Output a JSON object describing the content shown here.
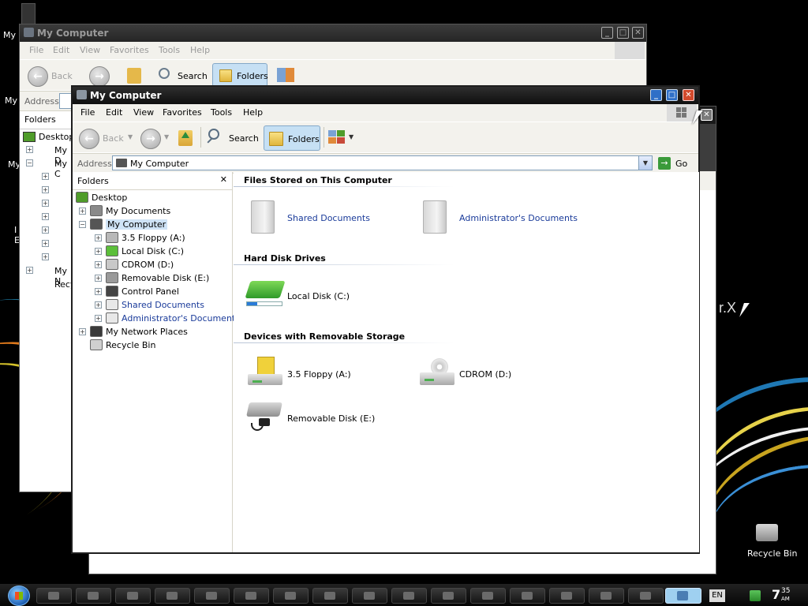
{
  "desktop": {
    "recycle_bin_label": "Recycle Bin",
    "right_text": "r.X",
    "left_labels": [
      "My I",
      "My",
      "My",
      "I",
      "E"
    ]
  },
  "back_window": {
    "title": "My Computer",
    "menu": [
      "File",
      "Edit",
      "View",
      "Favorites",
      "Tools",
      "Help"
    ],
    "toolbar": {
      "back": "Back",
      "search": "Search",
      "folders": "Folders"
    },
    "address_label": "Address",
    "folders_label": "Folders",
    "tree": [
      "Desktop",
      "My D",
      "My C",
      "My N",
      "Recy"
    ]
  },
  "front_window": {
    "title": "My Computer",
    "menu": [
      "File",
      "Edit",
      "View",
      "Favorites",
      "Tools",
      "Help"
    ],
    "toolbar": {
      "back": "Back",
      "search": "Search",
      "folders": "Folders"
    },
    "address": {
      "label": "Address",
      "value": "My Computer",
      "go": "Go"
    },
    "folders_pane": {
      "header": "Folders",
      "close_glyph": "✕",
      "tree": [
        {
          "label": "Desktop",
          "level": 0,
          "icon": "desktop-icon"
        },
        {
          "label": "My Documents",
          "level": 1,
          "icon": "my-documents-icon"
        },
        {
          "label": "My Computer",
          "level": 1,
          "icon": "my-computer-icon",
          "selected": true
        },
        {
          "label": "3.5 Floppy (A:)",
          "level": 2,
          "icon": "floppy-icon"
        },
        {
          "label": "Local Disk (C:)",
          "level": 2,
          "icon": "local-disk-icon"
        },
        {
          "label": "CDROM (D:)",
          "level": 2,
          "icon": "cdrom-icon"
        },
        {
          "label": "Removable Disk (E:)",
          "level": 2,
          "icon": "removable-disk-icon"
        },
        {
          "label": "Control Panel",
          "level": 2,
          "icon": "control-panel-icon"
        },
        {
          "label": "Shared Documents",
          "level": 2,
          "icon": "shared-documents-icon"
        },
        {
          "label": "Administrator's Documents",
          "level": 2,
          "icon": "admin-documents-icon"
        },
        {
          "label": "My Network Places",
          "level": 1,
          "icon": "network-places-icon"
        },
        {
          "label": "Recycle Bin",
          "level": 1,
          "icon": "recycle-bin-icon"
        }
      ]
    },
    "content": {
      "sections": [
        {
          "title": "Files Stored on This Computer",
          "items": [
            "Shared Documents",
            "Administrator's Documents"
          ]
        },
        {
          "title": "Hard Disk Drives",
          "items": [
            "Local Disk (C:)"
          ]
        },
        {
          "title": "Devices with Removable Storage",
          "items": [
            "3.5 Floppy (A:)",
            "CDROM (D:)",
            "Removable Disk (E:)"
          ]
        }
      ],
      "local_disk_usage_fraction": 0.3
    }
  },
  "taskbar": {
    "language": "EN",
    "clock_hour_min": "7",
    "clock_min": "35",
    "clock_ampm": "AM",
    "colors": {
      "active_button": "#9fd0f0",
      "bar": "#101010"
    }
  },
  "colors": {
    "titlebar_active": "#1c1c1c",
    "folders_button": "#c6e0f4",
    "selected_tree": "#cfe3f6",
    "link_blue": "#1a3b9a"
  }
}
